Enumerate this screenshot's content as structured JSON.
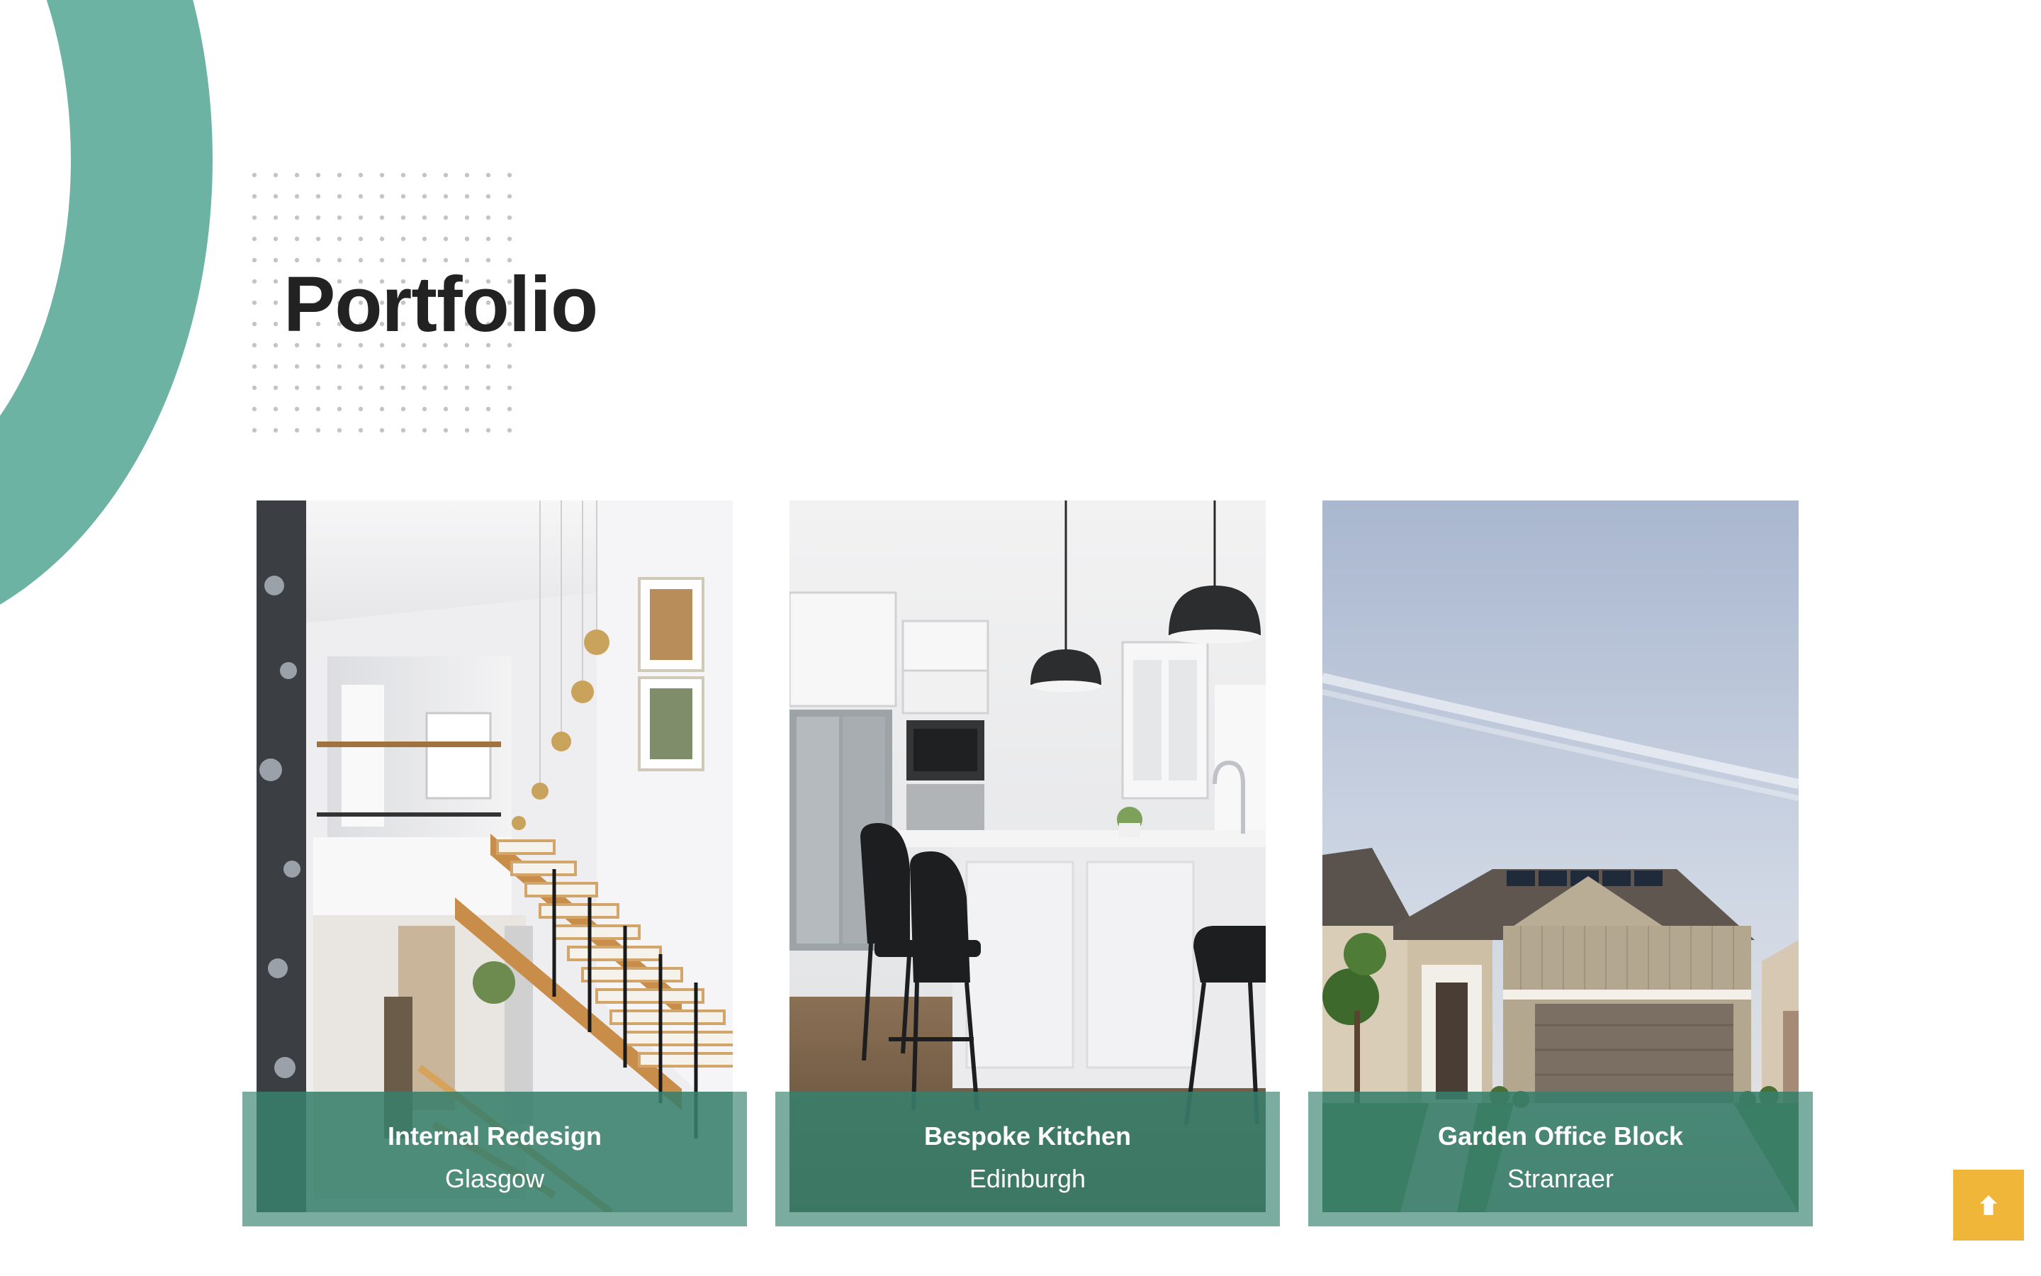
{
  "section": {
    "title": "Portfolio"
  },
  "portfolio": {
    "items": [
      {
        "title": "Internal Redesign",
        "location": "Glasgow"
      },
      {
        "title": "Bespoke Kitchen",
        "location": "Edinburgh"
      },
      {
        "title": "Garden Office Block",
        "location": "Stranraer"
      }
    ]
  },
  "colors": {
    "accent_green": "#6db3a3",
    "caption_green": "#468e7a",
    "scroll_button": "#f0b63a",
    "title_text": "#222222"
  },
  "icons": {
    "scroll_top": "arrow-up-icon"
  }
}
